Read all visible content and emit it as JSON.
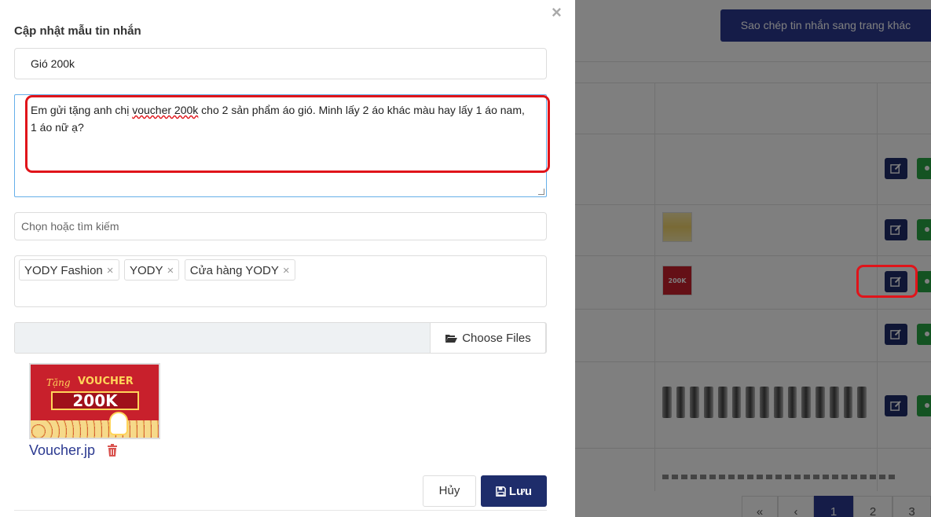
{
  "background": {
    "copy_button": "Sao chép tin nhắn sang trang khác",
    "pagination": [
      "«",
      "‹",
      "1",
      "2",
      "3"
    ],
    "thumb_label": "200K"
  },
  "modal": {
    "title": "Cập nhật mẫu tin nhắn",
    "name_value": "Gió 200k",
    "message_part1": "Em gửi tặng anh chị ",
    "message_part2": "voucher 200k",
    "message_part3": " cho 2 sản phẩm áo gió. Minh lấy 2 áo khác màu hay lấy 1 áo nam, 1 áo nữ ạ?",
    "search_placeholder": "Chọn hoặc tìm kiếm",
    "tags": [
      "YODY Fashion",
      "YODY",
      "Cửa hàng YODY"
    ],
    "tag_remove": "×",
    "choose_files": "Choose Files",
    "preview": {
      "tang": "Tặng",
      "voucher": "VOUCHER",
      "amount": "200K"
    },
    "file_name": "Voucher.jp",
    "cancel": "Hủy",
    "save": "Lưu",
    "close": "×"
  },
  "colors": {
    "primary": "#1e2d6b",
    "share": "#28a745",
    "highlight": "#e0141a"
  }
}
